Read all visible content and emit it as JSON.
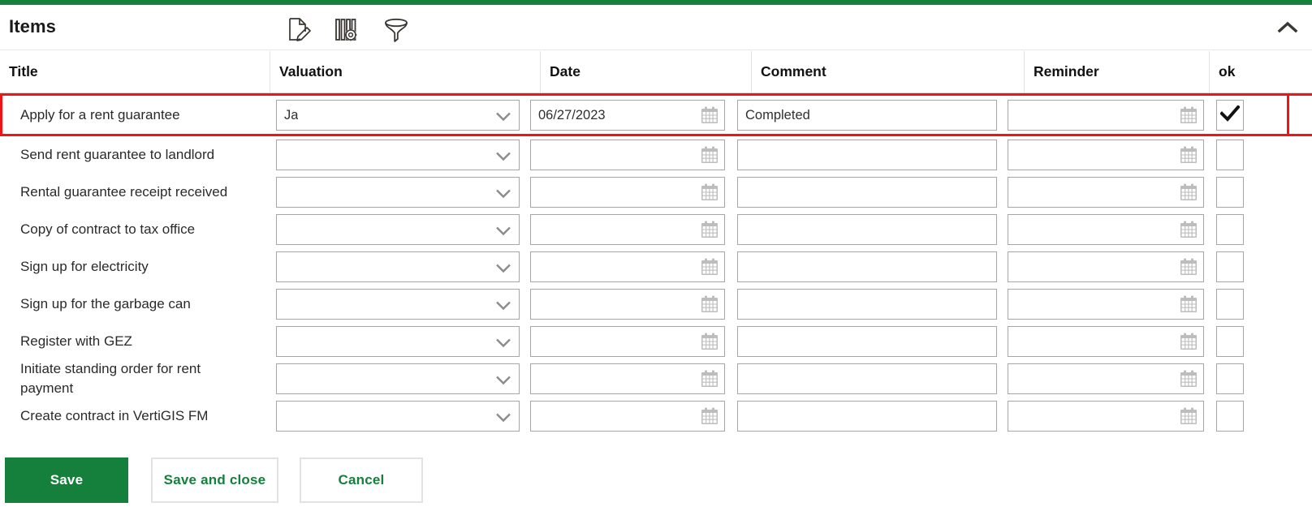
{
  "panel": {
    "title": "Items",
    "accent_color": "#16803c",
    "selection_color": "#f21414",
    "toolbar_icons": [
      {
        "name": "edit-document-icon",
        "label": "Edit"
      },
      {
        "name": "columns-settings-icon",
        "label": "Column settings"
      },
      {
        "name": "filter-icon",
        "label": "Filter"
      }
    ],
    "collapse_icon": "chevron-up-icon"
  },
  "table": {
    "columns": [
      {
        "key": "title",
        "label": "Title"
      },
      {
        "key": "valuation",
        "label": "Valuation"
      },
      {
        "key": "date",
        "label": "Date"
      },
      {
        "key": "comment",
        "label": "Comment"
      },
      {
        "key": "reminder",
        "label": "Reminder"
      },
      {
        "key": "ok",
        "label": "ok"
      }
    ],
    "rows": [
      {
        "title": "Apply for a rent guarantee",
        "valuation": "Ja",
        "date": "06/27/2023",
        "comment": "Completed",
        "reminder": "",
        "ok": true,
        "selected": true
      },
      {
        "title": "Send rent guarantee to landlord",
        "valuation": "",
        "date": "",
        "comment": "",
        "reminder": "",
        "ok": false,
        "selected": false
      },
      {
        "title": "Rental guarantee receipt received",
        "valuation": "",
        "date": "",
        "comment": "",
        "reminder": "",
        "ok": false,
        "selected": false
      },
      {
        "title": "Copy of contract to tax office",
        "valuation": "",
        "date": "",
        "comment": "",
        "reminder": "",
        "ok": false,
        "selected": false
      },
      {
        "title": "Sign up for electricity",
        "valuation": "",
        "date": "",
        "comment": "",
        "reminder": "",
        "ok": false,
        "selected": false
      },
      {
        "title": "Sign up for the garbage can",
        "valuation": "",
        "date": "",
        "comment": "",
        "reminder": "",
        "ok": false,
        "selected": false
      },
      {
        "title": "Register with GEZ",
        "valuation": "",
        "date": "",
        "comment": "",
        "reminder": "",
        "ok": false,
        "selected": false
      },
      {
        "title": "Initiate standing order for rent payment",
        "valuation": "",
        "date": "",
        "comment": "",
        "reminder": "",
        "ok": false,
        "selected": false
      },
      {
        "title": "Create contract in VertiGIS FM",
        "valuation": "",
        "date": "",
        "comment": "",
        "reminder": "",
        "ok": false,
        "selected": false
      }
    ]
  },
  "footer": {
    "buttons": [
      {
        "name": "save-button",
        "label": "Save",
        "style": "primary"
      },
      {
        "name": "save-and-close-button",
        "label": "Save and close",
        "style": "secondary"
      },
      {
        "name": "cancel-button",
        "label": "Cancel",
        "style": "secondary"
      }
    ]
  }
}
